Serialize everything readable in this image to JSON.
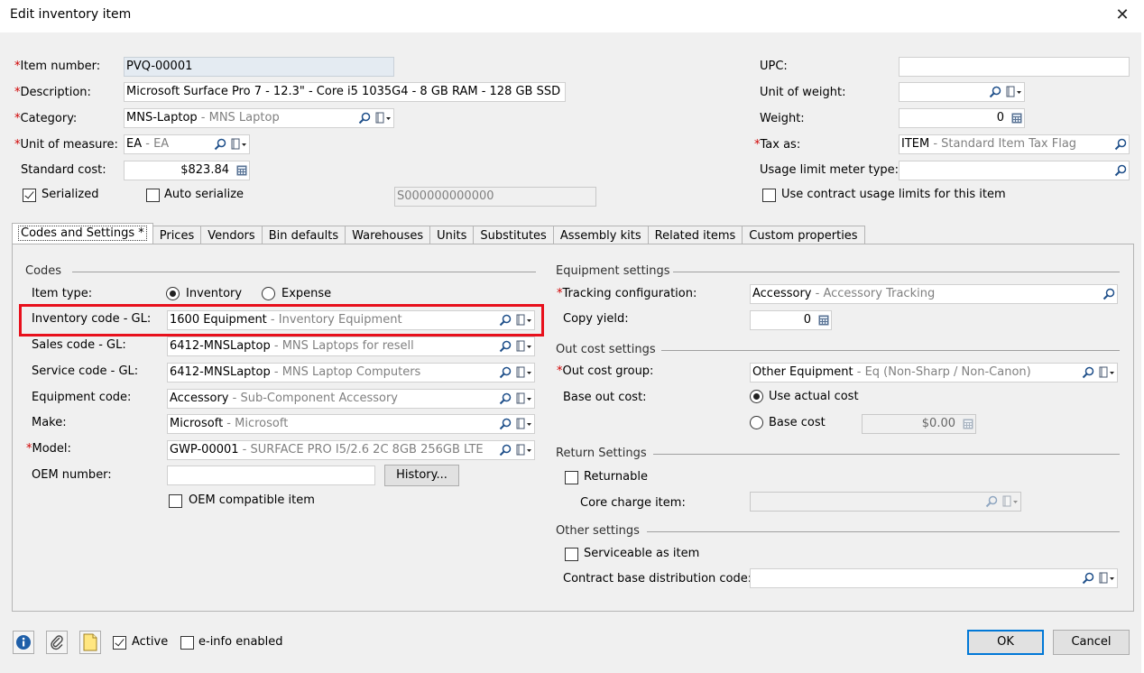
{
  "window": {
    "title": "Edit inventory item",
    "close_glyph": "✕"
  },
  "top_left": {
    "item_number": {
      "label": "Item number:",
      "value": "PVQ-00001"
    },
    "description": {
      "label": "Description:",
      "value": "Microsoft Surface Pro 7 - 12.3\" - Core i5 1035G4 - 8 GB RAM - 128 GB SSD"
    },
    "category": {
      "label": "Category:",
      "code": "MNS-Laptop",
      "desc": " - MNS Laptop"
    },
    "unit_of_measure": {
      "label": "Unit of measure:",
      "code": "EA",
      "desc": " - EA"
    },
    "standard_cost": {
      "label": "Standard cost:",
      "value": "$823.84"
    },
    "serialized": {
      "label": "Serialized",
      "checked": true
    },
    "auto_serialize": {
      "label": "Auto serialize",
      "checked": false
    },
    "serial_template": "S000000000000"
  },
  "top_right": {
    "upc": {
      "label": "UPC:",
      "value": ""
    },
    "unit_of_weight": {
      "label": "Unit of weight:",
      "value": ""
    },
    "weight": {
      "label": "Weight:",
      "value": "0"
    },
    "tax_as": {
      "label": "Tax as:",
      "code": "ITEM",
      "desc": " - Standard Item Tax Flag"
    },
    "usage_limit_meter_type": {
      "label": "Usage limit meter type:",
      "value": ""
    },
    "use_contract_usage_limits": {
      "label": "Use contract usage limits for this item",
      "checked": false
    }
  },
  "tabs": [
    {
      "label": "Codes and Settings  *",
      "active": true
    },
    {
      "label": "Prices"
    },
    {
      "label": "Vendors"
    },
    {
      "label": "Bin defaults"
    },
    {
      "label": "Warehouses"
    },
    {
      "label": "Units"
    },
    {
      "label": "Substitutes"
    },
    {
      "label": "Assembly kits"
    },
    {
      "label": "Related items"
    },
    {
      "label": "Custom properties"
    }
  ],
  "codes": {
    "title": "Codes",
    "item_type": {
      "label": "Item type:",
      "inventory": "Inventory",
      "expense": "Expense",
      "selected": "Inventory"
    },
    "inventory_code": {
      "label": "Inventory code - GL:",
      "code": "1600 Equipment",
      "desc": " - Inventory Equipment"
    },
    "sales_code": {
      "label": "Sales code - GL:",
      "code": "6412-MNSLaptop",
      "desc": " - MNS Laptops for resell"
    },
    "service_code": {
      "label": "Service code - GL:",
      "code": "6412-MNSLaptop",
      "desc": " - MNS Laptop Computers"
    },
    "equipment_code": {
      "label": "Equipment code:",
      "code": "Accessory",
      "desc": " - Sub-Component Accessory"
    },
    "make": {
      "label": "Make:",
      "code": "Microsoft",
      "desc": " - Microsoft"
    },
    "model": {
      "label": "Model:",
      "code": "GWP-00001",
      "desc": " - SURFACE PRO I5/2.6 2C 8GB 256GB LTE"
    },
    "oem_number": {
      "label": "OEM number:",
      "value": ""
    },
    "history_button": "History...",
    "oem_compatible": {
      "label": "OEM compatible item",
      "checked": false
    }
  },
  "equipment_settings": {
    "title": "Equipment settings",
    "tracking_configuration": {
      "label": "Tracking configuration:",
      "code": "Accessory",
      "desc": " - Accessory Tracking"
    },
    "copy_yield": {
      "label": "Copy yield:",
      "value": "0"
    }
  },
  "out_cost_settings": {
    "title": "Out cost settings",
    "out_cost_group": {
      "label": "Out cost group:",
      "code": "Other Equipment",
      "desc": " - Eq (Non-Sharp / Non-Canon)"
    },
    "base_out_cost": {
      "label": "Base out cost:",
      "use_actual": "Use actual cost",
      "base_cost": "Base cost",
      "selected": "Use actual cost",
      "base_cost_value": "$0.00"
    }
  },
  "return_settings": {
    "title": "Return Settings",
    "returnable": {
      "label": "Returnable",
      "checked": false
    },
    "core_charge_item": {
      "label": "Core charge item:",
      "value": ""
    }
  },
  "other_settings": {
    "title": "Other settings",
    "serviceable": {
      "label": "Serviceable as item",
      "checked": false
    },
    "contract_base_distribution_code": {
      "label": "Contract base distribution code:",
      "value": ""
    }
  },
  "footer": {
    "active": {
      "label": "Active",
      "checked": true
    },
    "einfo": {
      "label": "e-info enabled",
      "checked": false
    },
    "ok": "OK",
    "cancel": "Cancel",
    "icons": [
      "info-icon",
      "attachment-icon",
      "notes-icon"
    ]
  },
  "required_mark": "*",
  "colors": {
    "required": "#d00000",
    "highlight_box": "#e8101c",
    "ok_border": "#0078d7"
  }
}
